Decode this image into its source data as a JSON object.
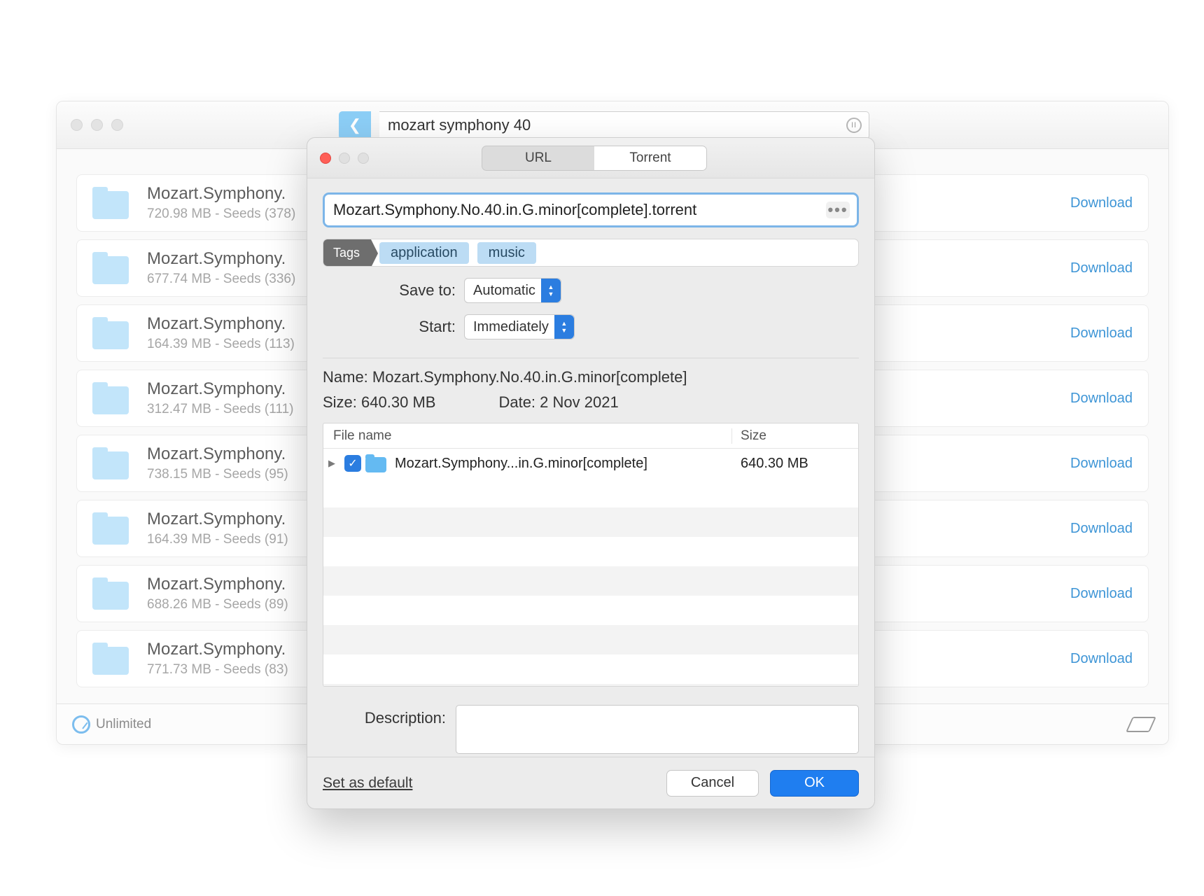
{
  "main": {
    "search_query": "mozart symphony 40",
    "download_label": "Download",
    "footer_speed": "Unlimited",
    "results": [
      {
        "title": "Mozart.Symphony.",
        "sub": "720.98 MB - Seeds (378)"
      },
      {
        "title": "Mozart.Symphony.",
        "sub": "677.74 MB - Seeds (336)"
      },
      {
        "title": "Mozart.Symphony.",
        "sub": "164.39 MB - Seeds (113)"
      },
      {
        "title": "Mozart.Symphony.",
        "sub": "312.47 MB - Seeds (111)"
      },
      {
        "title": "Mozart.Symphony.",
        "sub": "738.15 MB - Seeds (95)"
      },
      {
        "title": "Mozart.Symphony.",
        "sub": "164.39 MB - Seeds (91)"
      },
      {
        "title": "Mozart.Symphony.",
        "sub": "688.26 MB - Seeds (89)"
      },
      {
        "title": "Mozart.Symphony.",
        "sub": "771.73 MB - Seeds (83)"
      }
    ]
  },
  "sheet": {
    "tabs": {
      "url": "URL",
      "torrent": "Torrent"
    },
    "url_value": "Mozart.Symphony.No.40.in.G.minor[complete].torrent",
    "tags_label": "Tags",
    "tags": [
      "application",
      "music"
    ],
    "save_to_label": "Save to:",
    "save_to_value": "Automatic",
    "start_label": "Start:",
    "start_value": "Immediately",
    "name_label": "Name:",
    "name_value": "Mozart.Symphony.No.40.in.G.minor[complete]",
    "size_label": "Size:",
    "size_value": "640.30 MB",
    "date_label": "Date:",
    "date_value": "2 Nov 2021",
    "col_file": "File name",
    "col_size": "Size",
    "file_row_name": "Mozart.Symphony...in.G.minor[complete]",
    "file_row_size": "640.30 MB",
    "description_label": "Description:",
    "set_default": "Set as default",
    "cancel": "Cancel",
    "ok": "OK"
  }
}
